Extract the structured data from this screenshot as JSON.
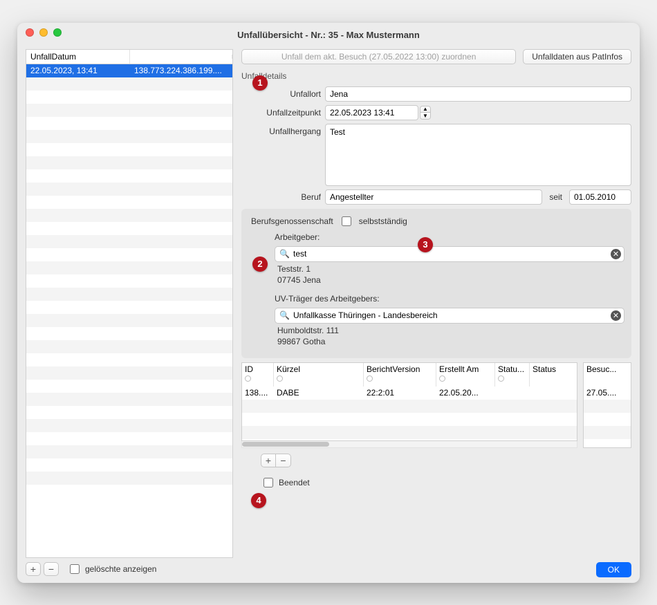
{
  "window": {
    "title": "Unfallübersicht - Nr.: 35 - Max Mustermann"
  },
  "left": {
    "header_col": "UnfallDatum",
    "selected": {
      "date": "22.05.2023, 13:41",
      "id": "138.773.224.386.199...."
    },
    "add": "+",
    "remove": "−",
    "show_deleted_label": "gelöschte anzeigen"
  },
  "top": {
    "assign_button": "Unfall dem akt. Besuch (27.05.2022 13:00) zuordnen",
    "patinfo_button": "Unfalldaten aus PatInfos"
  },
  "details": {
    "section": "Unfalldetails",
    "ort_label": "Unfallort",
    "ort_value": "Jena",
    "zeit_label": "Unfallzeitpunkt",
    "zeit_value": "22.05.2023 13:41",
    "hergang_label": "Unfallhergang",
    "hergang_value": "Test",
    "beruf_label": "Beruf",
    "beruf_value": "Angestellter",
    "seit_label": "seit",
    "seit_value": "01.05.2010"
  },
  "bg": {
    "bg_label": "Berufsgenossenschaft",
    "selbst_label": "selbstständig",
    "arbeitgeber_label": "Arbeitgeber:",
    "arbeitgeber_value": "test",
    "arbeitgeber_addr1": "Teststr. 1",
    "arbeitgeber_addr2": "07745 Jena",
    "uv_label": "UV-Träger des Arbeitgebers:",
    "uv_value": "Unfallkasse Thüringen - Landesbereich",
    "uv_addr1": "Humboldtstr. 111",
    "uv_addr2": "99867 Gotha"
  },
  "table1": {
    "headers": {
      "id": "ID",
      "kuerzel": "Kürzel",
      "bericht": "BerichtVersion",
      "erstellt": "Erstellt Am",
      "statu": "Statu...",
      "status": "Status"
    },
    "row": {
      "id": "138....",
      "kuerzel": "DABE",
      "bericht": "22:2:01",
      "erstellt": "22.05.20...",
      "statu": "",
      "status": ""
    }
  },
  "table2": {
    "header": "Besuc...",
    "row": "27.05...."
  },
  "report_buttons": {
    "add": "+",
    "remove": "−"
  },
  "ended_label": "Beendet",
  "ok": "OK",
  "badges": {
    "b1": "1",
    "b2": "2",
    "b3": "3",
    "b4": "4"
  }
}
